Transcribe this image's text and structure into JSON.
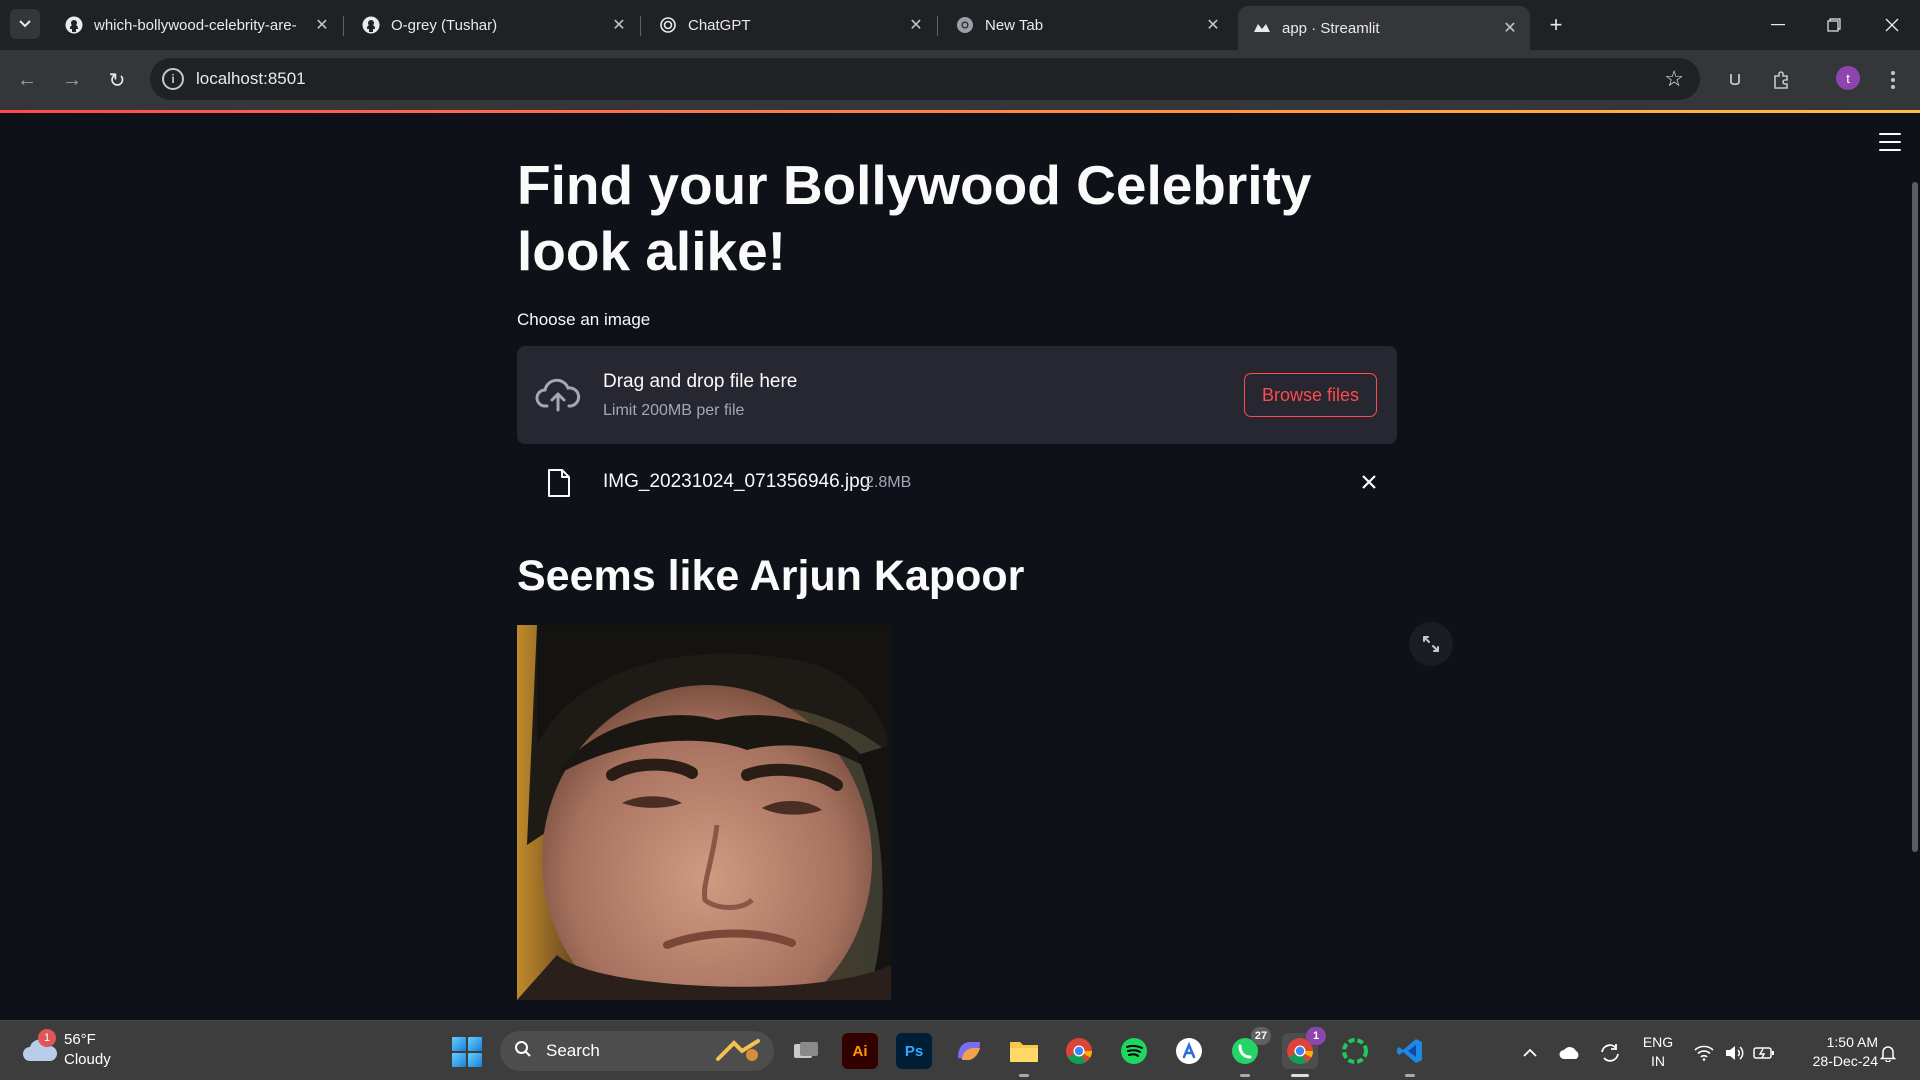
{
  "browser": {
    "tabs": [
      {
        "label": "which-bollywood-celebrity-are-",
        "icon": "github-icon"
      },
      {
        "label": "O-grey (Tushar)",
        "icon": "github-icon"
      },
      {
        "label": "ChatGPT",
        "icon": "chatgpt-icon"
      },
      {
        "label": "New Tab",
        "icon": "chrome-icon"
      },
      {
        "label": "app · Streamlit",
        "icon": "streamlit-icon"
      }
    ],
    "url": "localhost:8501",
    "profile_initial": "t"
  },
  "app": {
    "title": "Find your Bollywood Celebrity look alike!",
    "uploader": {
      "label": "Choose an image",
      "drop_text": "Drag and drop file here",
      "limit_text": "Limit 200MB per file",
      "browse_label": "Browse files"
    },
    "uploaded_file": {
      "name": "IMG_20231024_071356946.jpg",
      "size": "2.8MB"
    },
    "result_heading": "Seems like Arjun Kapoor",
    "colors": {
      "accent": "#ff4b4b",
      "background": "#0e1117",
      "dropzone": "#262730"
    }
  },
  "taskbar": {
    "weather": {
      "temp": "56°F",
      "condition": "Cloudy",
      "badge": "1"
    },
    "search_label": "Search",
    "whatsapp_badge": "27",
    "chrome_badge": "1",
    "language": {
      "line1": "ENG",
      "line2": "IN"
    },
    "clock": {
      "time": "1:50 AM",
      "date": "28-Dec-24"
    }
  }
}
